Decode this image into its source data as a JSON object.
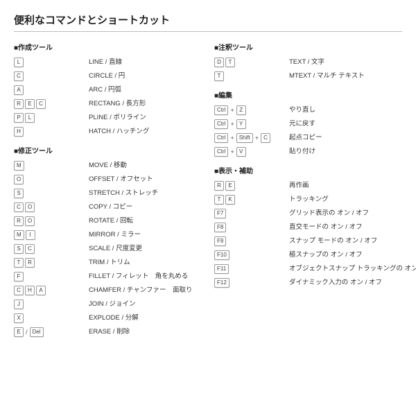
{
  "title": "便利なコマンドとショートカット",
  "left": [
    {
      "title": "■作成ツール",
      "rows": [
        {
          "keys": [
            [
              "L"
            ]
          ],
          "desc": "LINE / 直線"
        },
        {
          "keys": [
            [
              "C"
            ]
          ],
          "desc": "CIRCLE / 円"
        },
        {
          "keys": [
            [
              "A"
            ]
          ],
          "desc": "ARC / 円弧"
        },
        {
          "keys": [
            [
              "R",
              "E",
              "C"
            ]
          ],
          "desc": "RECTANG / 長方形"
        },
        {
          "keys": [
            [
              "P",
              "L"
            ]
          ],
          "desc": "PLINE / ポリライン"
        },
        {
          "keys": [
            [
              "H"
            ]
          ],
          "desc": "HATCH / ハッチング"
        }
      ]
    },
    {
      "title": "■修正ツール",
      "rows": [
        {
          "keys": [
            [
              "M"
            ]
          ],
          "desc": "MOVE / 移動"
        },
        {
          "keys": [
            [
              "O"
            ]
          ],
          "desc": "OFFSET / オフセット"
        },
        {
          "keys": [
            [
              "S"
            ]
          ],
          "desc": "STRETCH / ストレッチ"
        },
        {
          "keys": [
            [
              "C",
              "O"
            ]
          ],
          "desc": "COPY / コピー"
        },
        {
          "keys": [
            [
              "R",
              "O"
            ]
          ],
          "desc": "ROTATE / 回転"
        },
        {
          "keys": [
            [
              "M",
              "I"
            ]
          ],
          "desc": "MIRROR / ミラー"
        },
        {
          "keys": [
            [
              "S",
              "C"
            ]
          ],
          "desc": "SCALE / 尺度変更"
        },
        {
          "keys": [
            [
              "T",
              "R"
            ]
          ],
          "desc": "TRIM / トリム"
        },
        {
          "keys": [
            [
              "F"
            ]
          ],
          "desc": "FILLET / フィレット　角を丸める"
        },
        {
          "keys": [
            [
              "C",
              "H",
              "A"
            ]
          ],
          "desc": "CHAMFER / チャンファー　面取り"
        },
        {
          "keys": [
            [
              "J"
            ]
          ],
          "desc": "JOIN / ジョイン"
        },
        {
          "keys": [
            [
              "X"
            ]
          ],
          "desc": "EXPLODE / 分解"
        },
        {
          "keys": [
            [
              "E"
            ],
            [
              "Del"
            ]
          ],
          "sep": "/",
          "desc": "ERASE / 削除"
        }
      ]
    }
  ],
  "right": [
    {
      "title": "■注釈ツール",
      "rows": [
        {
          "keys": [
            [
              "D",
              "T"
            ]
          ],
          "desc": "TEXT / 文字"
        },
        {
          "keys": [
            [
              "T"
            ]
          ],
          "desc": "MTEXT / マルチ テキスト"
        }
      ]
    },
    {
      "title": "■編集",
      "rows": [
        {
          "keys": [
            [
              "Ctrl"
            ],
            [
              "Z"
            ]
          ],
          "sep": "+",
          "desc": "やり直し"
        },
        {
          "keys": [
            [
              "Ctrl"
            ],
            [
              "Y"
            ]
          ],
          "sep": "+",
          "desc": "元に戻す"
        },
        {
          "keys": [
            [
              "Ctrl"
            ],
            [
              "Shift"
            ],
            [
              "C"
            ]
          ],
          "sep": "+",
          "desc": "起点コピー"
        },
        {
          "keys": [
            [
              "Ctrl"
            ],
            [
              "V"
            ]
          ],
          "sep": "+",
          "desc": "貼り付け"
        }
      ]
    },
    {
      "title": "■表示・補助",
      "rows": [
        {
          "keys": [
            [
              "R",
              "E"
            ]
          ],
          "desc": "再作画"
        },
        {
          "keys": [
            [
              "T",
              "K"
            ]
          ],
          "desc": "トラッキング"
        },
        {
          "keys": [
            [
              "F7"
            ]
          ],
          "desc": "グリッド表示の オン / オフ"
        },
        {
          "keys": [
            [
              "F8"
            ]
          ],
          "desc": "直交モードの オン / オフ"
        },
        {
          "keys": [
            [
              "F9"
            ]
          ],
          "desc": "スナップ モードの オン / オフ"
        },
        {
          "keys": [
            [
              "F10"
            ]
          ],
          "desc": "極スナップの オン / オフ"
        },
        {
          "keys": [
            [
              "F11"
            ]
          ],
          "desc": "オブジェクトスナップ トラッキングの オン / オフ"
        },
        {
          "keys": [
            [
              "F12"
            ]
          ],
          "desc": "ダイナミック入力の オン / オフ"
        }
      ]
    }
  ]
}
